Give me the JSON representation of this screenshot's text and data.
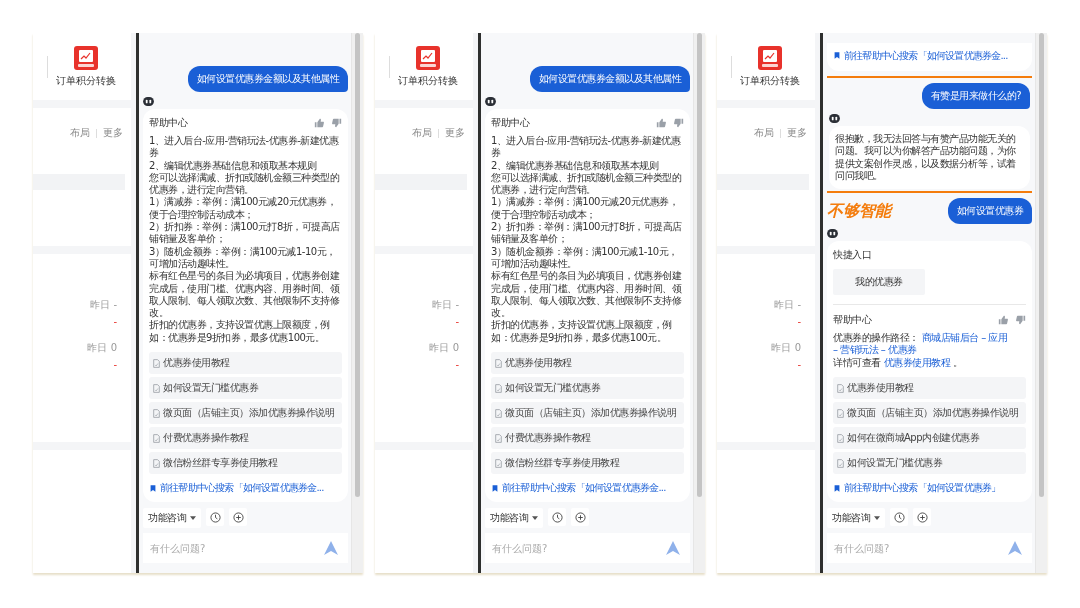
{
  "panels": [
    {
      "side": {
        "app_name": "订单积分转换",
        "layout_link": "布局",
        "more_link": "更多",
        "stats": [
          {
            "label": "昨日 -",
            "value": "-"
          },
          {
            "label": "昨日 0",
            "value": "-"
          }
        ]
      },
      "messages": [
        {
          "kind": "user",
          "text": "如何设置优惠券金额以及其他属性"
        },
        {
          "kind": "bot",
          "sections": [
            {
              "kind": "help",
              "title": "帮助中心",
              "paragraphs": [
                "1、进入后台-应用-营销玩法-优惠券-新建优惠券",
                "2、编辑优惠券基础信息和领取基本规则",
                "您可以选择满减、折扣或随机金额三种类型的优惠券，进行定向营销。",
                "1）满减券：举例：满100元减20元优惠券，便于合理控制活动成本；",
                "2）折扣券：举例：满100元打8折，可提高店铺销量及客单价；",
                "3）随机金额券：举例：满100元减1-10元，可增加活动趣味性。",
                "标有红色星号的条目为必填项目，优惠券创建完成后，使用门槛、优惠内容、用券时间、领取人限制、每人领取次数、其他限制不支持修改。",
                "折扣的优惠券，支持设置优惠上限额度，例如：优惠券是9折扣券，最多优惠100元。"
              ],
              "articles": [
                "优惠券使用教程",
                "如何设置无门槛优惠券",
                "微页面（店铺主页）添加优惠券操作说明",
                "付费优惠券操作教程",
                "微信粉丝群专享券使用教程"
              ],
              "search_link": "前往帮助中心搜索「如何设置优惠券金..."
            }
          ]
        }
      ],
      "toolbar": {
        "mode": "功能咨询",
        "placeholder": "有什么问题?"
      }
    },
    {
      "side": {
        "app_name": "订单积分转换",
        "layout_link": "布局",
        "more_link": "更多",
        "stats": [
          {
            "label": "昨日 -",
            "value": "-"
          },
          {
            "label": "昨日 0",
            "value": "-"
          }
        ]
      },
      "messages": [
        {
          "kind": "user",
          "text": "如何设置优惠券金额以及其他属性"
        },
        {
          "kind": "bot",
          "sections": [
            {
              "kind": "help",
              "title": "帮助中心",
              "paragraphs": [
                "1、进入后台-应用-营销玩法-优惠券-新建优惠券",
                "2、编辑优惠券基础信息和领取基本规则",
                "您可以选择满减、折扣或随机金额三种类型的优惠券，进行定向营销。",
                "1）满减券：举例：满100元减20元优惠券，便于合理控制活动成本；",
                "2）折扣券：举例：满100元打8折，可提高店铺销量及客单价；",
                "3）随机金额券：举例：满100元减1-10元，可增加活动趣味性。",
                "标有红色星号的条目为必填项目，优惠券创建完成后，使用门槛、优惠内容、用券时间、领取人限制、每人领取次数、其他限制不支持修改。",
                "折扣的优惠券，支持设置优惠上限额度，例如：优惠券是9折扣券，最多优惠100元。"
              ],
              "articles": [
                "优惠券使用教程",
                "如何设置无门槛优惠券",
                "微页面（店铺主页）添加优惠券操作说明",
                "付费优惠券操作教程",
                "微信粉丝群专享券使用教程"
              ],
              "search_link": "前往帮助中心搜索「如何设置优惠券金..."
            }
          ]
        }
      ],
      "toolbar": {
        "mode": "功能咨询",
        "placeholder": "有什么问题?"
      }
    },
    {
      "side": {
        "app_name": "订单积分转换",
        "layout_link": "布局",
        "more_link": "更多",
        "stats": [
          {
            "label": "昨日 -",
            "value": "-"
          },
          {
            "label": "昨日 0",
            "value": "-"
          }
        ]
      },
      "messages": [
        {
          "kind": "card_tail",
          "search_link": "前往帮助中心搜索「如何设置优惠券金..."
        },
        {
          "kind": "group",
          "highlighted": true,
          "messages": [
            {
              "kind": "user",
              "text": "有赞是用来做什么的?"
            },
            {
              "kind": "bot",
              "sections": [
                {
                  "kind": "text",
                  "paragraphs": [
                    "很抱歉，我无法回答与有赞产品功能无关的问题。我可以为你解答产品功能问题，为你提供文案创作灵感，以及数据分析等，试着问问我吧。"
                  ]
                }
              ]
            }
          ]
        },
        {
          "kind": "user",
          "text": "如何设置优惠券",
          "note": "不够智能"
        },
        {
          "kind": "bot",
          "sections": [
            {
              "kind": "shortcuts",
              "title": "快捷入口",
              "items": [
                "我的优惠券"
              ]
            },
            {
              "kind": "help",
              "title": "帮助中心",
              "paragraphs": [
                {
                  "parts": [
                    {
                      "text": "优惠券的操作路径：",
                      "link": false
                    },
                    {
                      "text": "商城店铺后台 – 应用",
                      "link": true
                    },
                    {
                      "text": "– 营销玩法 – 优惠券",
                      "link": true
                    }
                  ]
                },
                {
                  "parts": [
                    {
                      "text": "详情可查看",
                      "link": false
                    },
                    {
                      "text": "优惠券使用教程",
                      "link": true
                    },
                    {
                      "text": "。",
                      "link": false
                    }
                  ]
                }
              ],
              "articles": [
                "优惠券使用教程",
                "微页面（店铺主页）添加优惠券操作说明",
                "如何在微商城App内创建优惠券",
                "如何设置无门槛优惠券"
              ],
              "search_link": "前往帮助中心搜索「如何设置优惠券」"
            }
          ]
        }
      ],
      "toolbar": {
        "mode": "功能咨询",
        "placeholder": "有什么问题?"
      }
    }
  ]
}
